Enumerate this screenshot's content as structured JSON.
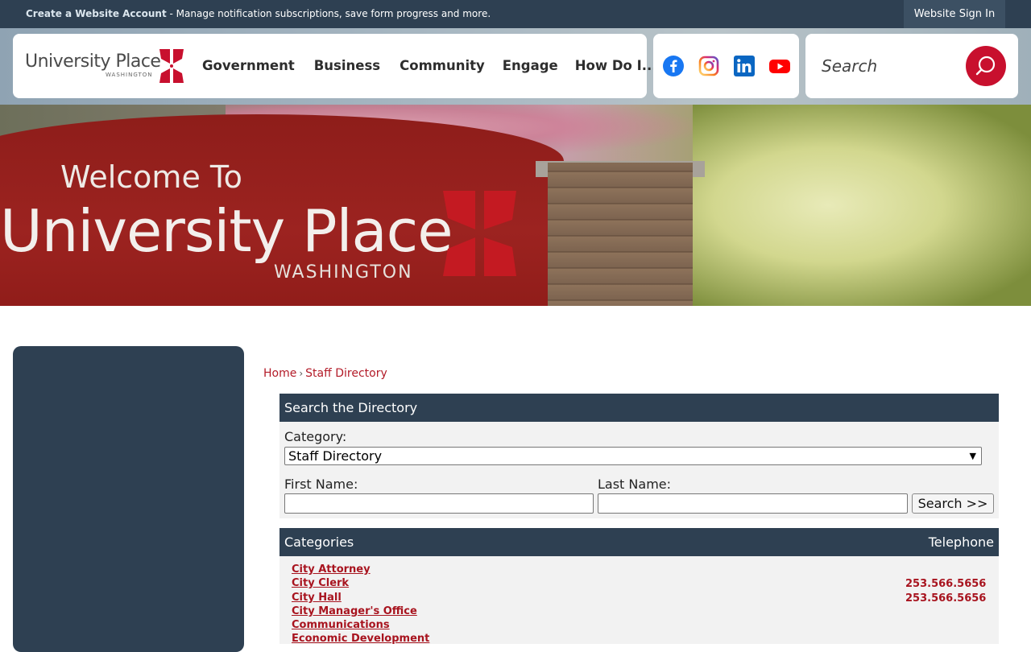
{
  "topbar": {
    "promo_link": "Create a Website Account",
    "promo_text": " - Manage notification subscriptions, save form progress and more.",
    "signin_label": "Website Sign In"
  },
  "header": {
    "logo_name": "University Place",
    "logo_sub": "WASHINGTON",
    "nav": [
      "Government",
      "Business",
      "Community",
      "Engage",
      "How Do I..."
    ],
    "social_icons": [
      "facebook-icon",
      "instagram-icon",
      "linkedin-icon",
      "youtube-icon"
    ],
    "search_placeholder": "Search"
  },
  "hero": {
    "welcome": "Welcome To",
    "city": "University Place",
    "state": "WASHINGTON"
  },
  "breadcrumb": {
    "home": "Home",
    "sep": "›",
    "current": "Staff Directory"
  },
  "directory": {
    "search_heading": "Search the Directory",
    "category_label": "Category:",
    "category_value": "Staff Directory",
    "first_name_label": "First Name:",
    "last_name_label": "Last Name:",
    "search_button": "Search >>",
    "categories_heading": "Categories",
    "telephone_heading": "Telephone",
    "categories": [
      {
        "name": "City Attorney",
        "phone": ""
      },
      {
        "name": "City Clerk",
        "phone": "253.566.5656"
      },
      {
        "name": "City Hall",
        "phone": "253.566.5656"
      },
      {
        "name": "City Manager's Office",
        "phone": ""
      },
      {
        "name": "Communications",
        "phone": ""
      },
      {
        "name": "Economic Development",
        "phone": ""
      }
    ]
  },
  "colors": {
    "navy": "#2e4052",
    "accent_red": "#c8102e",
    "link_red": "#a8141f"
  }
}
